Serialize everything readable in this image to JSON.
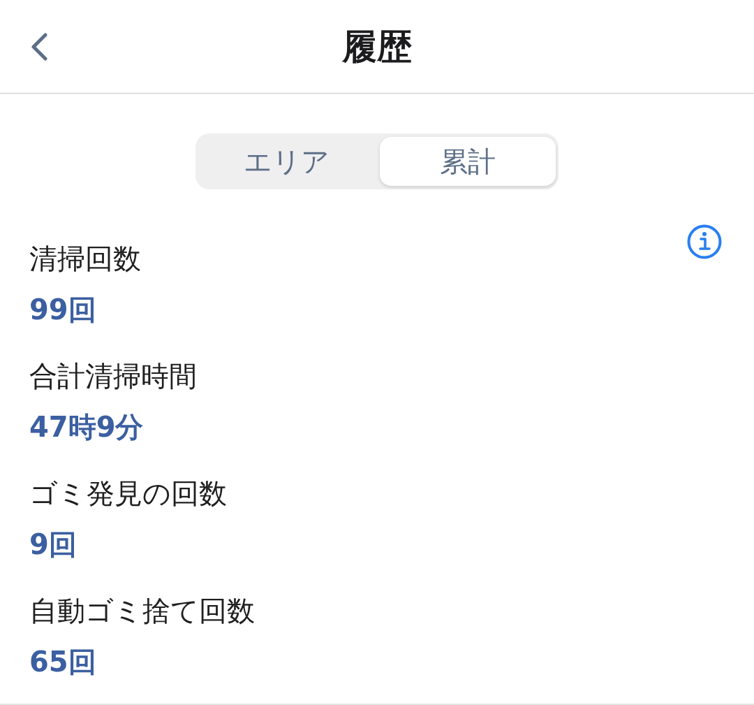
{
  "header": {
    "title": "履歴"
  },
  "tabs": [
    {
      "label": "エリア",
      "selected": false
    },
    {
      "label": "累計",
      "selected": true
    }
  ],
  "stats": [
    {
      "label": "清掃回数",
      "value": "99回"
    },
    {
      "label": "合計清掃時間",
      "value": "47時9分"
    },
    {
      "label": "ゴミ発見の回数",
      "value": "9回"
    },
    {
      "label": "自動ゴミ捨て回数",
      "value": "65回"
    }
  ]
}
